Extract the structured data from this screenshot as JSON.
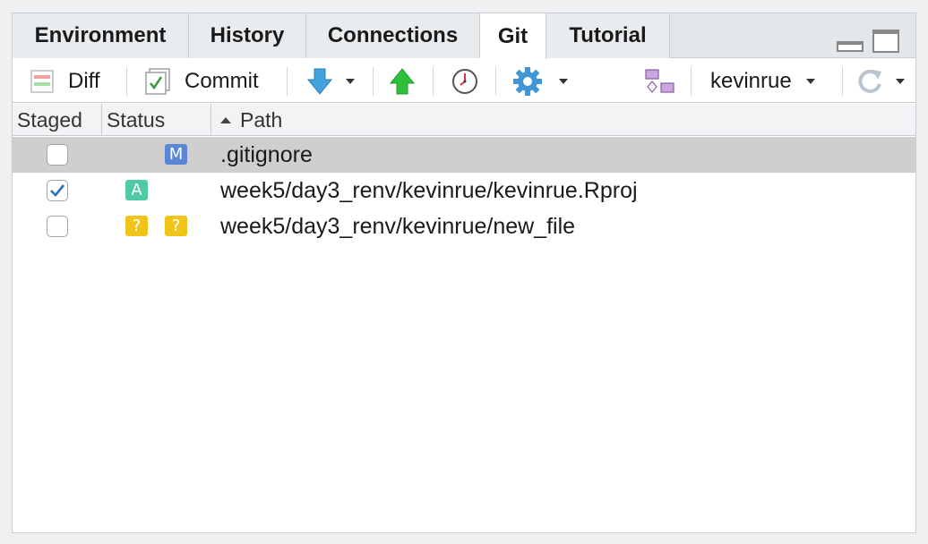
{
  "tabs": [
    {
      "label": "Environment",
      "active": false
    },
    {
      "label": "History",
      "active": false
    },
    {
      "label": "Connections",
      "active": false
    },
    {
      "label": "Git",
      "active": true
    },
    {
      "label": "Tutorial",
      "active": false
    }
  ],
  "toolbar": {
    "diff_label": "Diff",
    "commit_label": "Commit",
    "branch_label": "kevinrue"
  },
  "columns": {
    "staged": "Staged",
    "status": "Status",
    "path": "Path",
    "sort": "ascending"
  },
  "files": [
    {
      "staged": false,
      "status": [
        "M"
      ],
      "status_col": "worktree",
      "path": ".gitignore",
      "selected": true
    },
    {
      "staged": true,
      "status": [
        "A"
      ],
      "status_col": "index",
      "path": "week5/day3_renv/kevinrue/kevinrue.Rproj",
      "selected": false
    },
    {
      "staged": false,
      "status": [
        "?",
        "?"
      ],
      "status_col": "both",
      "path": "week5/day3_renv/kevinrue/new_file",
      "selected": false
    }
  ],
  "colors": {
    "modified": "#5b86d6",
    "added": "#4fc9a6",
    "untracked": "#f0c419",
    "selected_row": "#cfcfcf"
  }
}
